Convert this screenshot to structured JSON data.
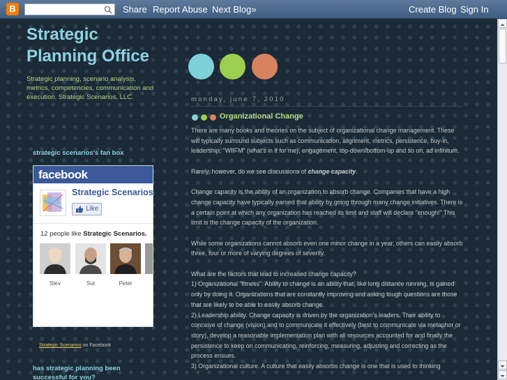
{
  "navbar": {
    "logo_letter": "B",
    "search_value": "",
    "share_label": "Share",
    "report_abuse_label": "Report Abuse",
    "next_blog_label": "Next Blog»",
    "create_blog_label": "Create Blog",
    "sign_in_label": "Sign In"
  },
  "sidebar": {
    "blog_title": "Strategic Planning Office",
    "blog_description": "Strategic planning, scenario analysis, metrics, competencies, communication and execution. Strategic Scenarios, LLC.",
    "fanbox_heading": "strategic scenarios's fan box",
    "fanbox": {
      "brand": "facebook",
      "page_name": "Strategic Scenarios",
      "like_label": "Like",
      "count_prefix": "12 people like ",
      "count_page": "Strategic Scenarios.",
      "fans": [
        {
          "name": "Stev"
        },
        {
          "name": "Sut"
        },
        {
          "name": "Peter"
        }
      ]
    },
    "fanbox_footer_link": "Strategic Scenarios",
    "fanbox_footer_text": " on Facebook",
    "next_heading": "has strategic planning been successful for you?"
  },
  "post": {
    "date": "monday, june 7, 2010",
    "title": "Organizational Change",
    "p1": "There are many books and theories on the subject of organizational change management. These will typically surround subjects such as communication, alignment, metrics, persistence, buy-in, leadership, \"WIIFM\" (what's in it for me), engagement, top-down/bottom-up and so on, ad infinitum.",
    "p2_prefix": "Rarely, however, do we see discussions of ",
    "p2_em": "change capacity",
    "p2_suffix": ".",
    "p3": "Change capacity is the ability of an organization to absorb change. Companies that have a high change capacity have typically earned that ability by going through many change initiatives. There is a certain point at which any organization has reached its limit and staff will declare \"enough!\" This limit is the change capacity of the organization.",
    "p4": "While some organizations cannot absorb even one minor change in a year, others can easily absorb three, four or more of varying degrees of severity.",
    "p5": "What are the factors that lead to increased change capacity?",
    "p6": "1) Organizational \"fitness\". Ability to change is an ability that, like long distance running, is gained only by doing it. Organizations that are constantly improving and asking tough questions are those that are likely to be able to easily absorb change.",
    "p7": "2) Leadership ability. Change capacity is driven by the organization's leaders. Their ability to conceive of change (vision) and to communicate it effectively (best to communicate via metaphor or story), develop a reasonable implementation plan with all resources accounted for and finally the persistence to keep on communicating, reinforcing, measuring, adjusting and correcting as the process ensues.",
    "p8": "3) Organizational culture. A culture that easily absorbs change is one that is used to thinking"
  },
  "colors": {
    "background": "#1b2a36",
    "dot_cyan": "#7dd1d9",
    "dot_green": "#9ccf50",
    "dot_orange": "#d98260",
    "title_cyan": "#8ed2e0",
    "accent_green": "#b7d886",
    "facebook_blue": "#3b5998"
  },
  "icons": {
    "logo": "blogger-logo-icon",
    "search": "search-icon",
    "like": "thumbs-up-icon",
    "scroll_up": "arrow-up-icon",
    "scroll_down": "arrow-down-icon"
  }
}
